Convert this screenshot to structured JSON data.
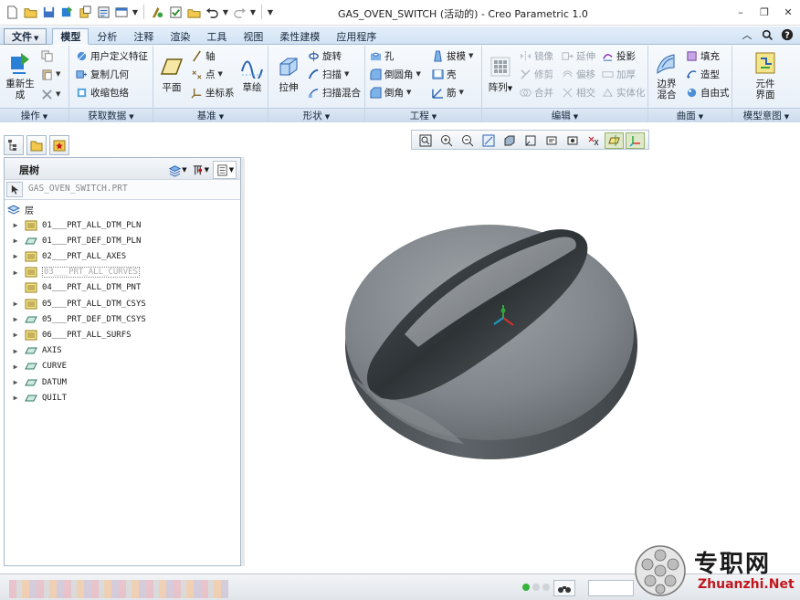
{
  "window": {
    "title": "GAS_OVEN_SWITCH (活动的) - Creo Parametric 1.0",
    "controls": [
      "–",
      "❐",
      "✕"
    ]
  },
  "tabs": {
    "file": "文件",
    "items": [
      "模型",
      "分析",
      "注释",
      "渲染",
      "工具",
      "视图",
      "柔性建模",
      "应用程序"
    ],
    "active": "模型"
  },
  "ribbon": {
    "operations": {
      "label": "操作",
      "regen": "重新生成"
    },
    "get_data": {
      "label": "获取数据",
      "user_feature": "用户定义特征",
      "copy_geom": "复制几何",
      "shrinkwrap": "收缩包络"
    },
    "datum": {
      "label": "基准",
      "plane": "平面",
      "axis": "轴",
      "point": "点",
      "csys": "坐标系",
      "sketch": "草绘"
    },
    "shapes": {
      "label": "形状",
      "extrude": "拉伸",
      "revolve": "旋转",
      "sweep": "扫描",
      "swept_blend": "扫描混合"
    },
    "engineering": {
      "label": "工程",
      "hole": "孔",
      "round": "倒圆角",
      "chamfer": "倒角",
      "draft": "拔模",
      "shell": "壳",
      "rib": "筋"
    },
    "editing": {
      "label": "编辑",
      "pattern": "阵列",
      "mirror": "镜像",
      "extend": "延伸",
      "project": "投影",
      "trim": "修剪",
      "offset": "偏移",
      "thicken": "加厚",
      "merge": "合并",
      "intersect": "相交",
      "solidify": "实体化"
    },
    "surfaces": {
      "label": "曲面",
      "boundary_blend": "边界混合",
      "fill": "填充",
      "style": "造型",
      "freestyle": "自由式"
    },
    "model_intent": {
      "label": "模型意图",
      "component_interface": "元件界面"
    }
  },
  "panel": {
    "title": "层树",
    "model_path": "GAS_OVEN_SWITCH.PRT",
    "root_label": "层",
    "layers": [
      {
        "label": "01___PRT_ALL_DTM_PLN",
        "icon": "layer-group-icon",
        "expandable": true,
        "dim": false
      },
      {
        "label": "01___PRT_DEF_DTM_PLN",
        "icon": "layer-plane-icon",
        "expandable": true,
        "dim": false
      },
      {
        "label": "02___PRT_ALL_AXES",
        "icon": "layer-group-icon",
        "expandable": true,
        "dim": false
      },
      {
        "label": "03___PRT_ALL_CURVES",
        "icon": "layer-group-icon",
        "expandable": true,
        "dim": true
      },
      {
        "label": "04___PRT_ALL_DTM_PNT",
        "icon": "layer-group-icon",
        "expandable": false,
        "dim": false
      },
      {
        "label": "05___PRT_ALL_DTM_CSYS",
        "icon": "layer-group-icon",
        "expandable": true,
        "dim": false
      },
      {
        "label": "05___PRT_DEF_DTM_CSYS",
        "icon": "layer-plane-icon",
        "expandable": true,
        "dim": false
      },
      {
        "label": "06___PRT_ALL_SURFS",
        "icon": "layer-group-icon",
        "expandable": true,
        "dim": false
      },
      {
        "label": "AXIS",
        "icon": "layer-plane-icon",
        "expandable": true,
        "dim": false
      },
      {
        "label": "CURVE",
        "icon": "layer-plane-icon",
        "expandable": true,
        "dim": false
      },
      {
        "label": "DATUM",
        "icon": "layer-plane-icon",
        "expandable": true,
        "dim": false
      },
      {
        "label": "QUILT",
        "icon": "layer-plane-icon",
        "expandable": true,
        "dim": false
      }
    ]
  },
  "colors": {
    "model": "#6f7479",
    "csys_x": "#e0302a",
    "csys_y": "#2fa83a",
    "csys_z": "#1aa0c8",
    "status_led": "#35b33a"
  },
  "watermark": {
    "cn": "专职网",
    "en": "Zhuanzhi.Net"
  }
}
